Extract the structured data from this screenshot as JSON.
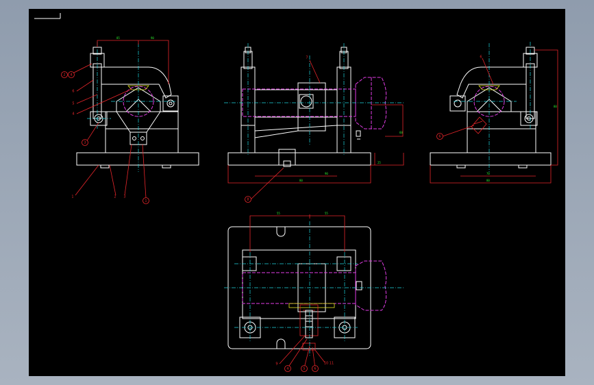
{
  "colors": {
    "window_bg": "#9aa6b4",
    "canvas_bg": "#000000",
    "outline": "#ffffff",
    "centerline": "#1fd6e0",
    "dimension": "#e8262b",
    "workpiece": "#e23de6",
    "dimension_text": "#2ee82e"
  },
  "views": [
    {
      "id": "front-view",
      "balloons": [
        "2",
        "4",
        "6",
        "5",
        "4",
        "3",
        "1",
        "2",
        "3",
        "1"
      ]
    },
    {
      "id": "side-view",
      "balloons": [
        "7",
        "8"
      ]
    },
    {
      "id": "right-view",
      "balloons": [
        "6",
        "6"
      ]
    },
    {
      "id": "top-view",
      "balloons": [
        "9",
        "4",
        "5",
        "6",
        "10"
      ]
    }
  ]
}
